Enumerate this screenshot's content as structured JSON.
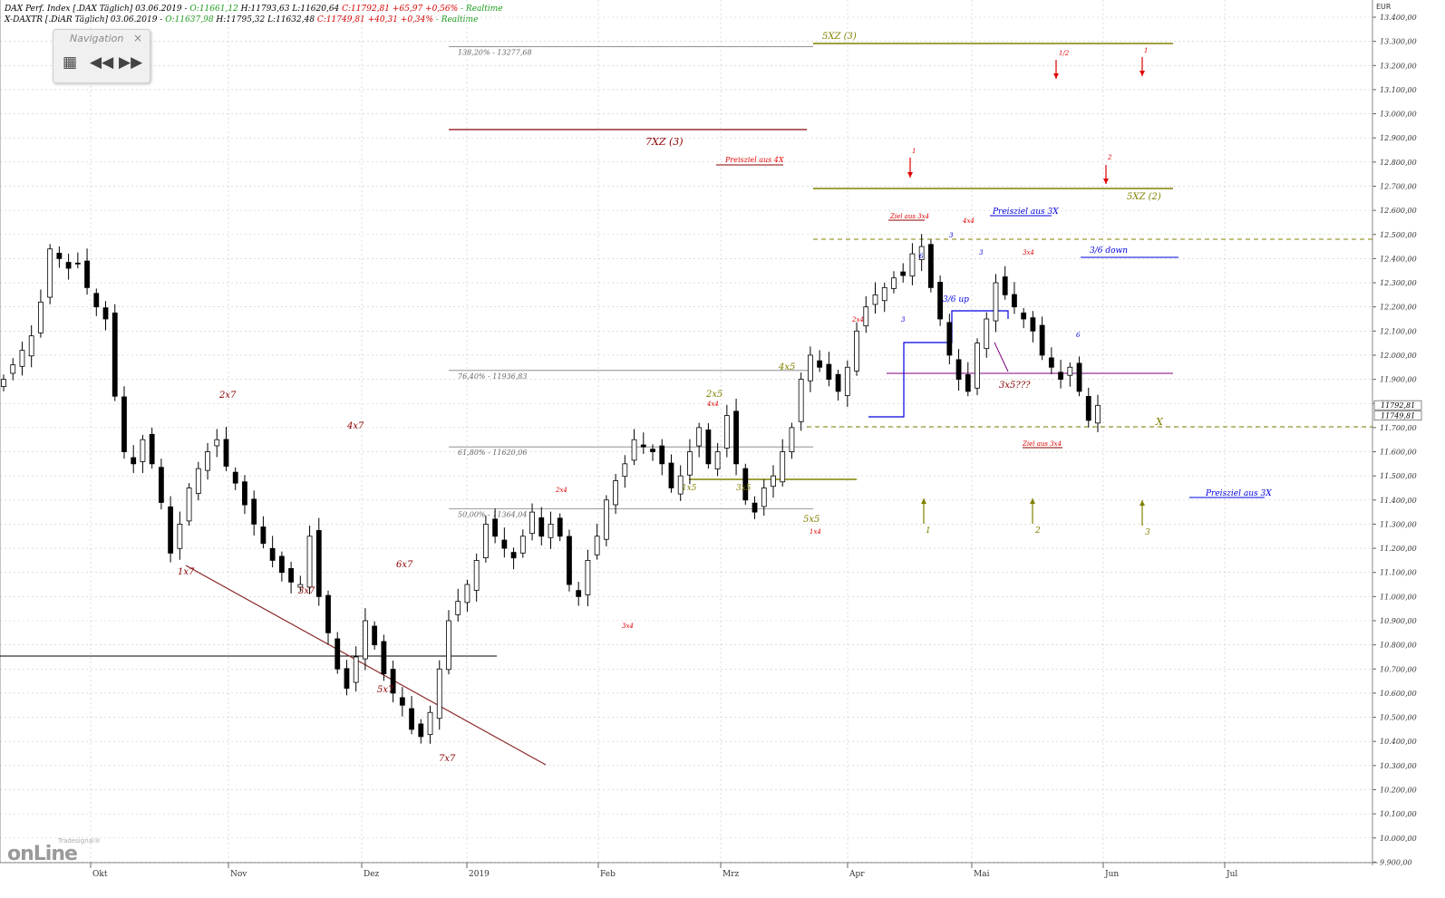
{
  "header": {
    "line1": {
      "label": "DAX Perf. Index [.DAX Täglich] 03.06.2019 - ",
      "open": "O:11661,12",
      "hl": " H:11793,63 L:11620,64 ",
      "close": "C:11792,81 +65,97 +0,56%",
      "rt": " - Realtime"
    },
    "line2": {
      "label": "X-DAXTR [.DiAR Täglich] 03.06.2019 - ",
      "open": "O:11637,98",
      "hl": " H:11795,32 L:11632,48 ",
      "close": "C:11749,81 +40,31 +0,34%",
      "rt": " - Realtime"
    }
  },
  "navigation": {
    "title": "Navigation",
    "close": "×",
    "grid_icon": "grid-icon",
    "back_icon": "rewind-icon",
    "fwd_icon": "fast-forward-icon"
  },
  "logo": {
    "text": "onLine",
    "brand": "Tradesignal®"
  },
  "colors": {
    "dark_red": "#8b0000",
    "red": "#e00000",
    "olive": "#808000",
    "blue": "#0000e0",
    "purple": "#800080",
    "grey": "#808080"
  },
  "chart_data": {
    "type": "candlestick",
    "currency": "EUR",
    "y_range": [
      9780,
      13400
    ],
    "y_ticks": [
      "13.400,00",
      "13.300,00",
      "13.200,00",
      "13.100,00",
      "13.000,00",
      "12.900,00",
      "12.800,00",
      "12.700,00",
      "12.600,00",
      "12.500,00",
      "12.400,00",
      "12.300,00",
      "12.200,00",
      "12.100,00",
      "12.000,00",
      "11.900,00",
      "11.800,00",
      "11.700,00",
      "11.600,00",
      "11.500,00",
      "11.400,00",
      "11.300,00",
      "11.200,00",
      "11.100,00",
      "11.000,00",
      "10.900,00",
      "10.800,00",
      "10.700,00",
      "10.600,00",
      "10.500,00",
      "10.400,00",
      "10.300,00",
      "10.200,00",
      "10.100,00",
      "10.000,00",
      "9.900,00"
    ],
    "price_markers": [
      "11792,81",
      "11749,81"
    ],
    "x_labels": [
      "Okt",
      "Nov",
      "Dez",
      "2019",
      "Feb",
      "Mrz",
      "Apr",
      "Mai",
      "Jun",
      "Jul"
    ],
    "fib_levels": [
      {
        "label": "138,20% - 13277,68",
        "value": 13277.68
      },
      {
        "label": "76,40% - 11936,83",
        "value": 11936.83
      },
      {
        "label": "61,80% - 11620,06",
        "value": 11620.06
      },
      {
        "label": "50,00% - 11364,04",
        "value": 11364.04
      }
    ],
    "close_path": [
      11900,
      11960,
      12020,
      12080,
      12220,
      12440,
      12400,
      12360,
      12380,
      12280,
      12200,
      12150,
      11830,
      11600,
      11550,
      11650,
      11550,
      11390,
      11180,
      11300,
      11450,
      11530,
      11600,
      11650,
      11540,
      11470,
      11380,
      11300,
      11220,
      11150,
      11100,
      11060,
      11050,
      11250,
      11000,
      10850,
      10700,
      10620,
      10750,
      10900,
      10800,
      10680,
      10600,
      10550,
      10450,
      10420,
      10520,
      10700,
      10900,
      10980,
      11050,
      11150,
      11300,
      11250,
      11200,
      11160,
      11250,
      11350,
      11250,
      11300,
      11250,
      11050,
      11000,
      11150,
      11250,
      11400,
      11480,
      11550,
      11650,
      11620,
      11600,
      11550,
      11450,
      11500,
      11600,
      11700,
      11550,
      11600,
      11750,
      11550,
      11400,
      11350,
      11450,
      11500,
      11600,
      11700,
      11900,
      12000,
      11950,
      11900,
      11850,
      11950,
      12100,
      12200,
      12250,
      12280,
      12320,
      12330,
      12420,
      12450,
      12280,
      12150,
      12000,
      11900,
      11850,
      12050,
      12150,
      12300,
      12250,
      12200,
      12150,
      12100,
      12000,
      11950,
      11900,
      11950,
      11850,
      11730,
      11792
    ]
  },
  "annotations": {
    "xz_5_3": "5XZ (3)",
    "xz_7_3": "7XZ (3)",
    "xz_5_2": "5XZ (2)",
    "preisziel_4x": "Preisziel aus 4X",
    "preisziel_3x_top": "Preisziel aus 3X",
    "preisziel_3x_bottom": "Preisziel aus 3X",
    "ziel_3x4_top": "Ziel aus 3x4",
    "ziel_3x4_bottom": "Ziel aus 3x4",
    "down_36": "3/6 down",
    "up_36": "3/6 up",
    "x_mark": "X",
    "q_3x5": "3x5???",
    "w_1x7": "1x7",
    "w_2x7": "2x7",
    "w_3x7": "3x7",
    "w_4x7": "4x7",
    "w_5x7": "5x7",
    "w_6x7": "6x7",
    "w_7x7": "7x7",
    "w_2x5": "2x5",
    "w_4x5": "4x5",
    "w_5x5": "5x5",
    "w_1x5": "1x5",
    "w_3x5": "3x5",
    "w_4x4a": "4x4",
    "w_2x4": "2x4",
    "w_3x4": "3x4",
    "w_1x4": "1x4",
    "w_2x4b": "2x4",
    "w_4x4b": "4x4",
    "w_3x4b": "3x4",
    "n_1": "1",
    "n_2": "2",
    "n_3": "3",
    "n_12": "1/2",
    "n_1top": "1",
    "n_1mid": "1",
    "n_2mid": "2",
    "b_3a": "3",
    "b_3b": "3",
    "b_6a": "6",
    "b_3c": "3",
    "b_6b": "6"
  }
}
